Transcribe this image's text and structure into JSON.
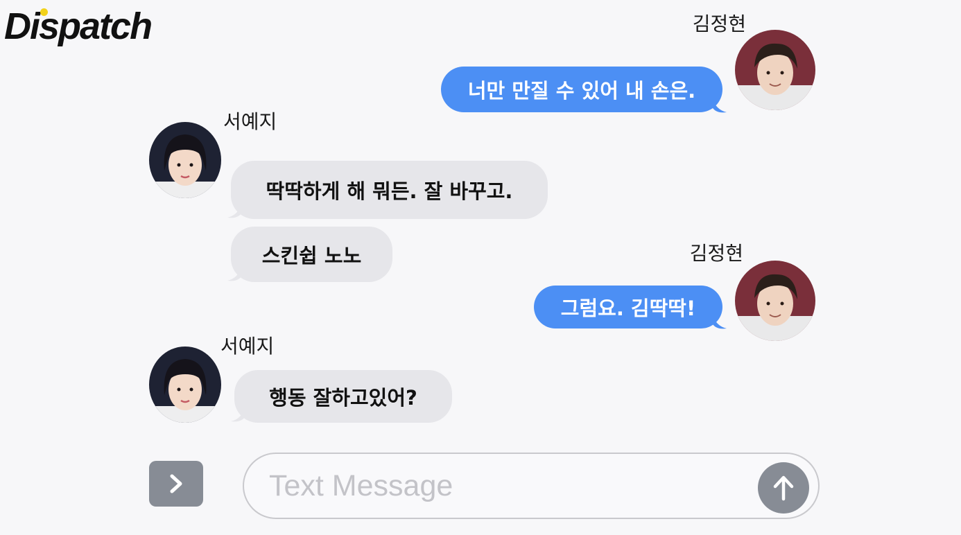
{
  "brand": {
    "logo_text": "Dispatch"
  },
  "messages": [
    {
      "sender": "김정현",
      "direction": "outgoing",
      "text": "너만 만질 수 있어 내 손은."
    },
    {
      "sender": "서예지",
      "direction": "incoming",
      "text": "딱딱하게 해 뭐든. 잘 바꾸고."
    },
    {
      "sender": "서예지",
      "direction": "incoming",
      "text": "스킨쉽 노노"
    },
    {
      "sender": "김정현",
      "direction": "outgoing",
      "text": "그럼요. 김딱딱!"
    },
    {
      "sender": "서예지",
      "direction": "incoming",
      "text": "행동 잘하고있어?"
    }
  ],
  "composer": {
    "placeholder": "Text Message",
    "value": "",
    "expand_icon": "chevron-right-icon",
    "send_icon": "arrow-up-icon"
  },
  "colors": {
    "outgoing_bubble": "#4c8ff4",
    "incoming_bubble": "#e6e6ea",
    "button_gray": "#878c95",
    "logo_accent": "#f2d21b"
  }
}
